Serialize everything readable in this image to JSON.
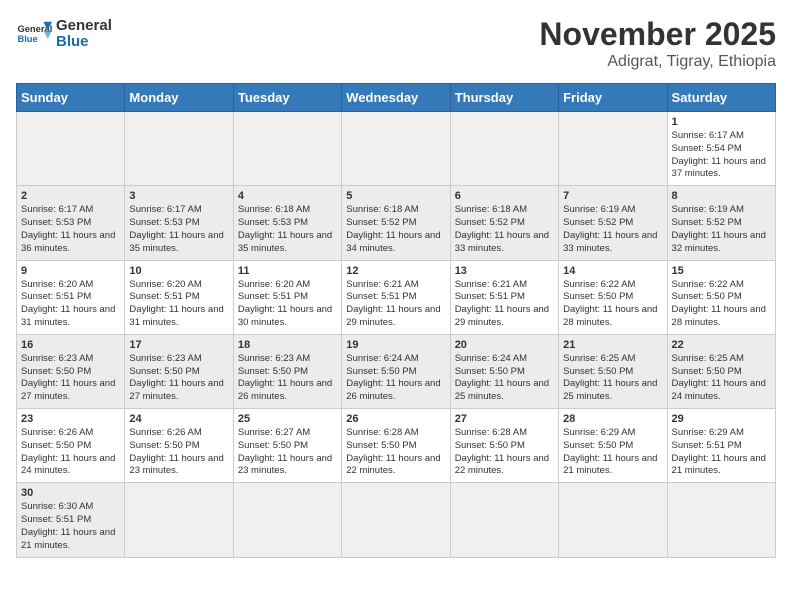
{
  "header": {
    "logo_general": "General",
    "logo_blue": "Blue",
    "month_title": "November 2025",
    "location": "Adigrat, Tigray, Ethiopia"
  },
  "weekdays": [
    "Sunday",
    "Monday",
    "Tuesday",
    "Wednesday",
    "Thursday",
    "Friday",
    "Saturday"
  ],
  "weeks": [
    [
      {
        "day": "",
        "info": ""
      },
      {
        "day": "",
        "info": ""
      },
      {
        "day": "",
        "info": ""
      },
      {
        "day": "",
        "info": ""
      },
      {
        "day": "",
        "info": ""
      },
      {
        "day": "",
        "info": ""
      },
      {
        "day": "1",
        "info": "Sunrise: 6:17 AM\nSunset: 5:54 PM\nDaylight: 11 hours and 37 minutes."
      }
    ],
    [
      {
        "day": "2",
        "info": "Sunrise: 6:17 AM\nSunset: 5:53 PM\nDaylight: 11 hours and 36 minutes."
      },
      {
        "day": "3",
        "info": "Sunrise: 6:17 AM\nSunset: 5:53 PM\nDaylight: 11 hours and 35 minutes."
      },
      {
        "day": "4",
        "info": "Sunrise: 6:18 AM\nSunset: 5:53 PM\nDaylight: 11 hours and 35 minutes."
      },
      {
        "day": "5",
        "info": "Sunrise: 6:18 AM\nSunset: 5:52 PM\nDaylight: 11 hours and 34 minutes."
      },
      {
        "day": "6",
        "info": "Sunrise: 6:18 AM\nSunset: 5:52 PM\nDaylight: 11 hours and 33 minutes."
      },
      {
        "day": "7",
        "info": "Sunrise: 6:19 AM\nSunset: 5:52 PM\nDaylight: 11 hours and 33 minutes."
      },
      {
        "day": "8",
        "info": "Sunrise: 6:19 AM\nSunset: 5:52 PM\nDaylight: 11 hours and 32 minutes."
      }
    ],
    [
      {
        "day": "9",
        "info": "Sunrise: 6:20 AM\nSunset: 5:51 PM\nDaylight: 11 hours and 31 minutes."
      },
      {
        "day": "10",
        "info": "Sunrise: 6:20 AM\nSunset: 5:51 PM\nDaylight: 11 hours and 31 minutes."
      },
      {
        "day": "11",
        "info": "Sunrise: 6:20 AM\nSunset: 5:51 PM\nDaylight: 11 hours and 30 minutes."
      },
      {
        "day": "12",
        "info": "Sunrise: 6:21 AM\nSunset: 5:51 PM\nDaylight: 11 hours and 29 minutes."
      },
      {
        "day": "13",
        "info": "Sunrise: 6:21 AM\nSunset: 5:51 PM\nDaylight: 11 hours and 29 minutes."
      },
      {
        "day": "14",
        "info": "Sunrise: 6:22 AM\nSunset: 5:50 PM\nDaylight: 11 hours and 28 minutes."
      },
      {
        "day": "15",
        "info": "Sunrise: 6:22 AM\nSunset: 5:50 PM\nDaylight: 11 hours and 28 minutes."
      }
    ],
    [
      {
        "day": "16",
        "info": "Sunrise: 6:23 AM\nSunset: 5:50 PM\nDaylight: 11 hours and 27 minutes."
      },
      {
        "day": "17",
        "info": "Sunrise: 6:23 AM\nSunset: 5:50 PM\nDaylight: 11 hours and 27 minutes."
      },
      {
        "day": "18",
        "info": "Sunrise: 6:23 AM\nSunset: 5:50 PM\nDaylight: 11 hours and 26 minutes."
      },
      {
        "day": "19",
        "info": "Sunrise: 6:24 AM\nSunset: 5:50 PM\nDaylight: 11 hours and 26 minutes."
      },
      {
        "day": "20",
        "info": "Sunrise: 6:24 AM\nSunset: 5:50 PM\nDaylight: 11 hours and 25 minutes."
      },
      {
        "day": "21",
        "info": "Sunrise: 6:25 AM\nSunset: 5:50 PM\nDaylight: 11 hours and 25 minutes."
      },
      {
        "day": "22",
        "info": "Sunrise: 6:25 AM\nSunset: 5:50 PM\nDaylight: 11 hours and 24 minutes."
      }
    ],
    [
      {
        "day": "23",
        "info": "Sunrise: 6:26 AM\nSunset: 5:50 PM\nDaylight: 11 hours and 24 minutes."
      },
      {
        "day": "24",
        "info": "Sunrise: 6:26 AM\nSunset: 5:50 PM\nDaylight: 11 hours and 23 minutes."
      },
      {
        "day": "25",
        "info": "Sunrise: 6:27 AM\nSunset: 5:50 PM\nDaylight: 11 hours and 23 minutes."
      },
      {
        "day": "26",
        "info": "Sunrise: 6:28 AM\nSunset: 5:50 PM\nDaylight: 11 hours and 22 minutes."
      },
      {
        "day": "27",
        "info": "Sunrise: 6:28 AM\nSunset: 5:50 PM\nDaylight: 11 hours and 22 minutes."
      },
      {
        "day": "28",
        "info": "Sunrise: 6:29 AM\nSunset: 5:50 PM\nDaylight: 11 hours and 21 minutes."
      },
      {
        "day": "29",
        "info": "Sunrise: 6:29 AM\nSunset: 5:51 PM\nDaylight: 11 hours and 21 minutes."
      }
    ],
    [
      {
        "day": "30",
        "info": "Sunrise: 6:30 AM\nSunset: 5:51 PM\nDaylight: 11 hours and 21 minutes."
      },
      {
        "day": "",
        "info": ""
      },
      {
        "day": "",
        "info": ""
      },
      {
        "day": "",
        "info": ""
      },
      {
        "day": "",
        "info": ""
      },
      {
        "day": "",
        "info": ""
      },
      {
        "day": "",
        "info": ""
      }
    ]
  ]
}
